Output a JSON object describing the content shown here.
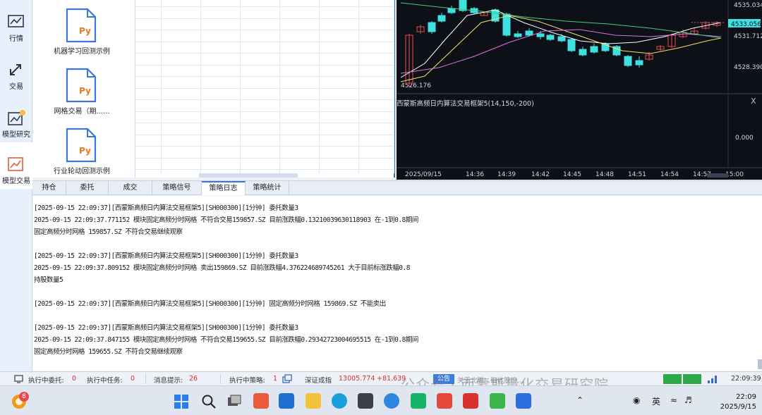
{
  "nav": {
    "items": [
      {
        "label": "行情",
        "icon": "chart-line-icon"
      },
      {
        "label": "交易",
        "icon": "trade-arrows-icon"
      },
      {
        "label": "模型研究",
        "icon": "model-research-icon"
      },
      {
        "label": "模型交易",
        "icon": "model-trade-icon"
      }
    ]
  },
  "strategies": [
    {
      "icon_text": "Py",
      "name": "机器学习回测示例"
    },
    {
      "icon_text": "Py",
      "name": "网格交易（期......"
    },
    {
      "icon_text": "Py",
      "name": "行业轮动回测示例"
    }
  ],
  "chart": {
    "price_labels": [
      "4535.034",
      "4533.056",
      "4531.712",
      "4528.390"
    ],
    "low_label": "4526.176",
    "sub_title": "西蒙斯高频日内算法交易框架5(14,150,-200)",
    "sub_close": "X",
    "sub_zero": "0.000",
    "x_labels": [
      "2025/09/15",
      "14:36",
      "14:39",
      "14:42",
      "14:45",
      "14:48",
      "14:51",
      "14:54",
      "14:57",
      "15:00"
    ],
    "colors": {
      "up": "#e84e4e",
      "down": "#3fe0e0",
      "ma1": "#ffffff",
      "ma2": "#f0e26a",
      "ma3": "#e070e0",
      "ma4": "#3fcf7a"
    }
  },
  "tabs": [
    "持仓",
    "委托",
    "成交",
    "策略信号",
    "策略日志",
    "策略统计"
  ],
  "active_tab": "策略日志",
  "log_lines": [
    "[2025-09-15 22:09:37][西蒙斯高频日内算法交易框架5][SH000300][1分钟] 委托数量3",
    "2025-09-15 22:09:37.771152 模块固定高频分时网格 不符合交易159857.SZ  目前涨跌幅0.13210039630118903 在-1到0.8期间",
    "固定高频分时网格 159857.SZ 不符合交易继续观察",
    "",
    "[2025-09-15 22:09:37][西蒙斯高频日内算法交易框架5][SH000300][1分钟] 委托数量3",
    "2025-09-15 22:09:37.809152 模块固定高频分时网格 卖出159869.SZ  目前涨跌幅4.376224689745261 大于目前标涨跌幅0.8",
    "持股数量5",
    "",
    "[2025-09-15 22:09:37][西蒙斯高频日内算法交易框架5][SH000300][1分钟] 固定高频分时网格 159869.SZ 不能卖出",
    "",
    "[2025-09-15 22:09:37][西蒙斯高频日内算法交易框架5][SH000300][1分钟] 委托数量3",
    "2025-09-15 22:09:37.847155 模块固定高频分时网格 不符合交易159655.SZ  目前涨跌幅0.29342723004695515 在-1到0.8期间",
    "固定高频分时网格 159655.SZ 不符合交易继续观察"
  ],
  "status": {
    "pending_orders_label": "执行中委托:",
    "pending_orders_value": "0",
    "running_tasks_label": "执行中任务:",
    "running_tasks_value": "0",
    "messages_label": "消息提示:",
    "messages_value": "26",
    "running_strategies_label": "执行中策略:",
    "running_strategies_value": "1",
    "index_name": "深证成指",
    "index_value": "13005.774",
    "index_change": "+81.639",
    "notice_label": "公告",
    "notice_text": "关于北磁...磁体股份...",
    "time": "22:09:39"
  },
  "watermark": "公众号 · 西蒙斯量化交易研究院",
  "taskbar": {
    "time": "22:09",
    "date": "2025/9/15",
    "ime": "英",
    "badge": "8"
  }
}
